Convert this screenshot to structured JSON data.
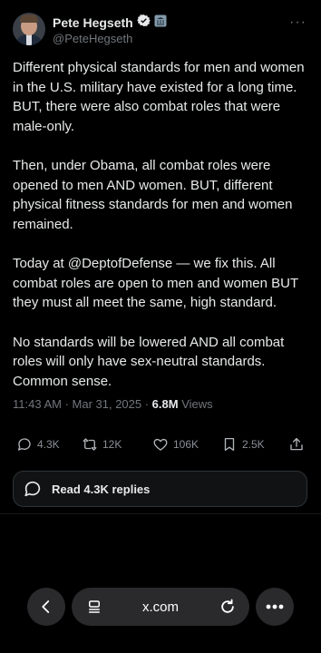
{
  "author": {
    "name": "Pete Hegseth",
    "handle": "@PeteHegseth"
  },
  "post": {
    "paragraphs": [
      "Different physical standards for men and women in the U.S. military have existed for a long time. BUT, there were also combat roles that were male-only.",
      "Then, under Obama, all combat roles were opened to men AND women. BUT, different physical fitness standards for men and women remained.",
      "Today at @DeptofDefense — we fix this. All combat roles are open to men and women BUT they must all meet the same, high standard.",
      "No standards will be lowered AND all combat roles will only have sex-neutral standards. Common sense."
    ],
    "timestamp": "11:43 AM · Mar 31, 2025 · ",
    "views_count": "6.8M",
    "views_label": " Views"
  },
  "actions": {
    "replies": "4.3K",
    "reposts": "12K",
    "likes": "106K",
    "bookmarks": "2.5K"
  },
  "read_replies_label": "Read 4.3K replies",
  "browser": {
    "url": "x.com"
  },
  "colors": {
    "background": "#000000",
    "text": "#e7e9ea",
    "muted": "#71767b",
    "verified_gold": "#e2b719",
    "gov_badge": "#829aab"
  },
  "icons": {
    "verified": "verified-badge-icon",
    "gov": "gov-affiliation-icon",
    "more": "more-dots-icon",
    "reply": "reply-icon",
    "repost": "repost-icon",
    "like": "heart-icon",
    "bookmark": "bookmark-icon",
    "share": "share-icon",
    "back": "chevron-left-icon",
    "tabs": "tabs-icon",
    "reload": "reload-icon",
    "menu": "more-dots-icon"
  }
}
